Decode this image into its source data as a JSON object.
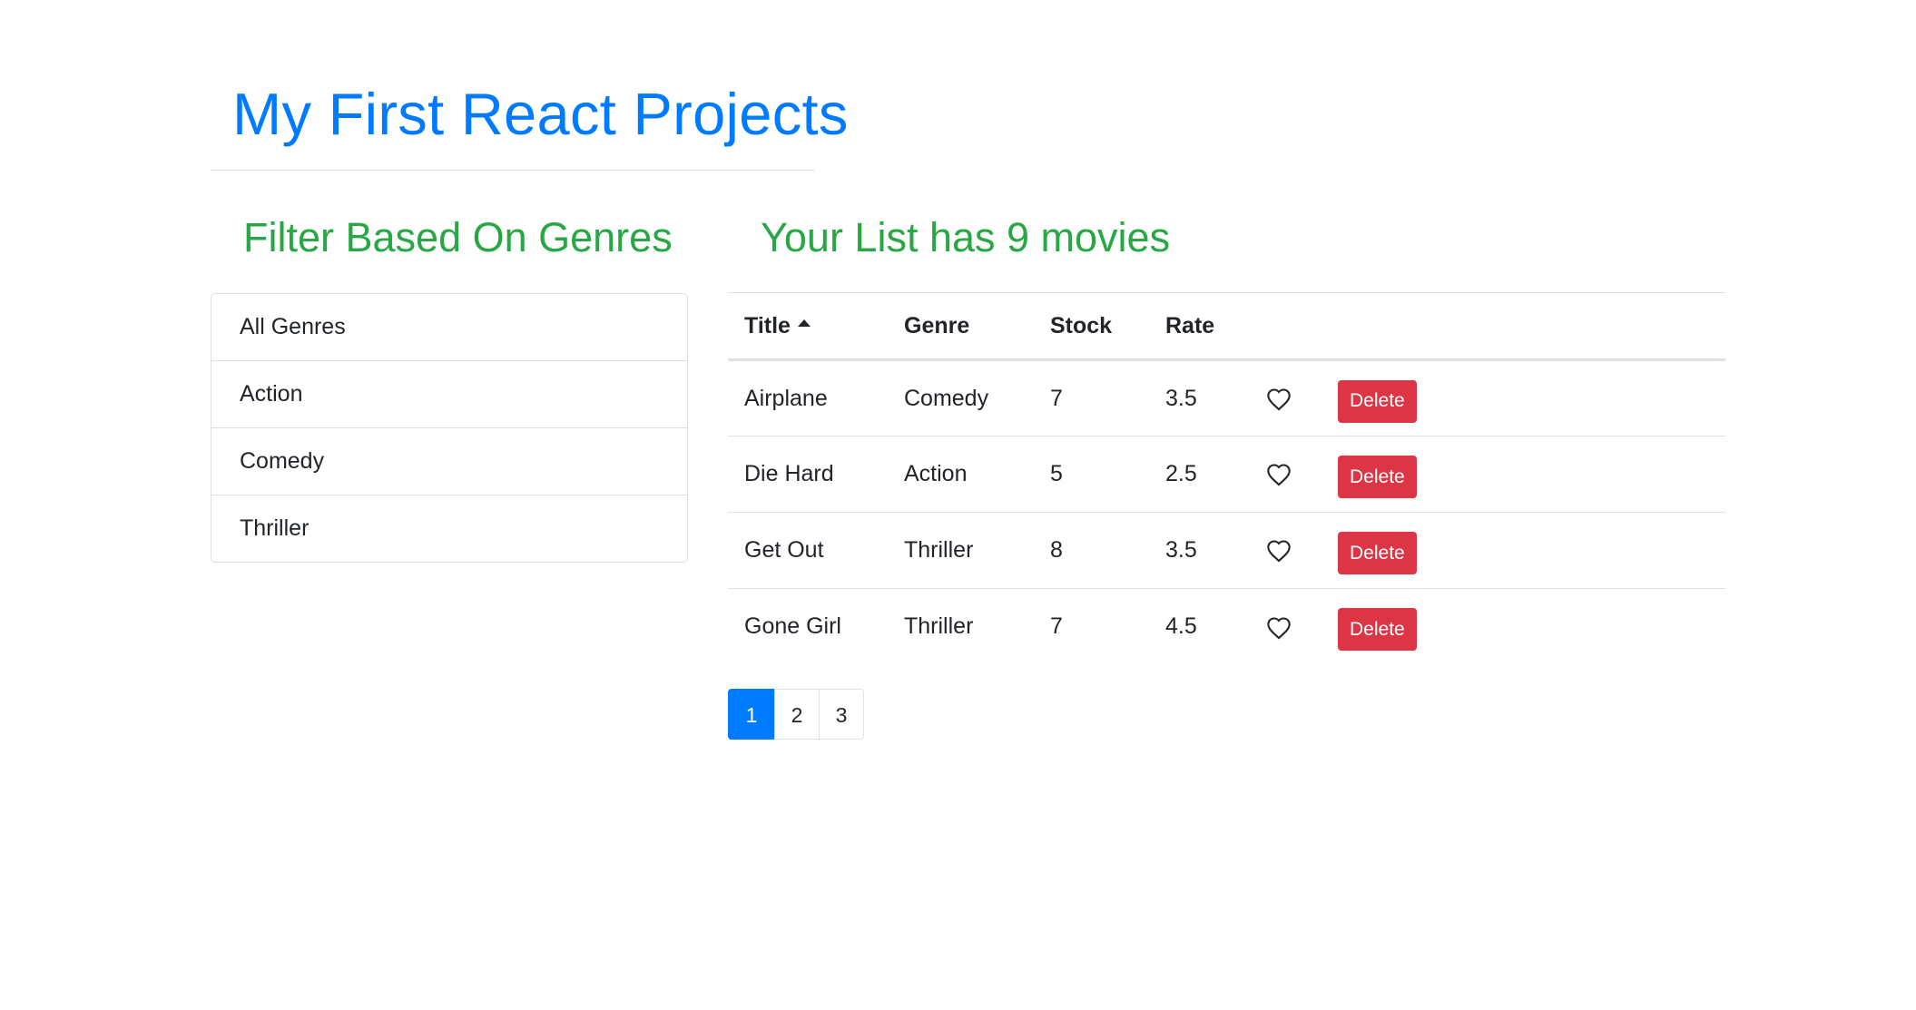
{
  "app": {
    "title": "My First React Projects"
  },
  "sidebar": {
    "heading": "Filter Based On Genres",
    "genres": [
      "All Genres",
      "Action",
      "Comedy",
      "Thriller"
    ]
  },
  "main": {
    "heading": "Your List has 9 movies",
    "sort": {
      "column": "Title",
      "direction": "ascending"
    },
    "columns": [
      "Title",
      "Genre",
      "Stock",
      "Rate"
    ],
    "movies": [
      {
        "title": "Airplane",
        "genre": "Comedy",
        "stock": "7",
        "rate": "3.5",
        "liked": false,
        "delete_label": "Delete"
      },
      {
        "title": "Die Hard",
        "genre": "Action",
        "stock": "5",
        "rate": "2.5",
        "liked": false,
        "delete_label": "Delete"
      },
      {
        "title": "Get Out",
        "genre": "Thriller",
        "stock": "8",
        "rate": "3.5",
        "liked": false,
        "delete_label": "Delete"
      },
      {
        "title": "Gone Girl",
        "genre": "Thriller",
        "stock": "7",
        "rate": "4.5",
        "liked": false,
        "delete_label": "Delete"
      }
    ]
  },
  "pagination": {
    "pages": [
      "1",
      "2",
      "3"
    ],
    "current": "1"
  },
  "colors": {
    "primary": "#007bff",
    "success": "#28a745",
    "danger": "#dc3545",
    "border": "#dee2e6"
  },
  "icons": {
    "like": "heart-outline-icon",
    "sort": "caret-up-icon"
  }
}
